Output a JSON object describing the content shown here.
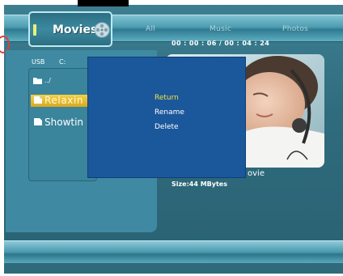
{
  "nav": {
    "active_tab": "Movies",
    "tabs": [
      "All",
      "Music",
      "Photos"
    ]
  },
  "playback": {
    "time": "00 : 00 : 06 / 00 : 04 : 24"
  },
  "browser": {
    "device": "USB",
    "drive": "C:",
    "items": [
      {
        "name": "../",
        "icon": "folder-up-icon"
      },
      {
        "name": "Relaxin",
        "icon": "video-file-icon",
        "selected": true
      },
      {
        "name": "Showtin",
        "icon": "video-file-icon"
      }
    ]
  },
  "preview": {
    "name_fragment": "ovie",
    "size": "Size:44 MBytes"
  },
  "context_menu": {
    "items": [
      "Return",
      "Rename",
      "Delete"
    ],
    "highlighted_index": 0
  },
  "colors": {
    "background": "#2f6c7e",
    "dialog": "#1b579b",
    "highlight": "#f5e13c",
    "selection": "#e8b92c"
  }
}
